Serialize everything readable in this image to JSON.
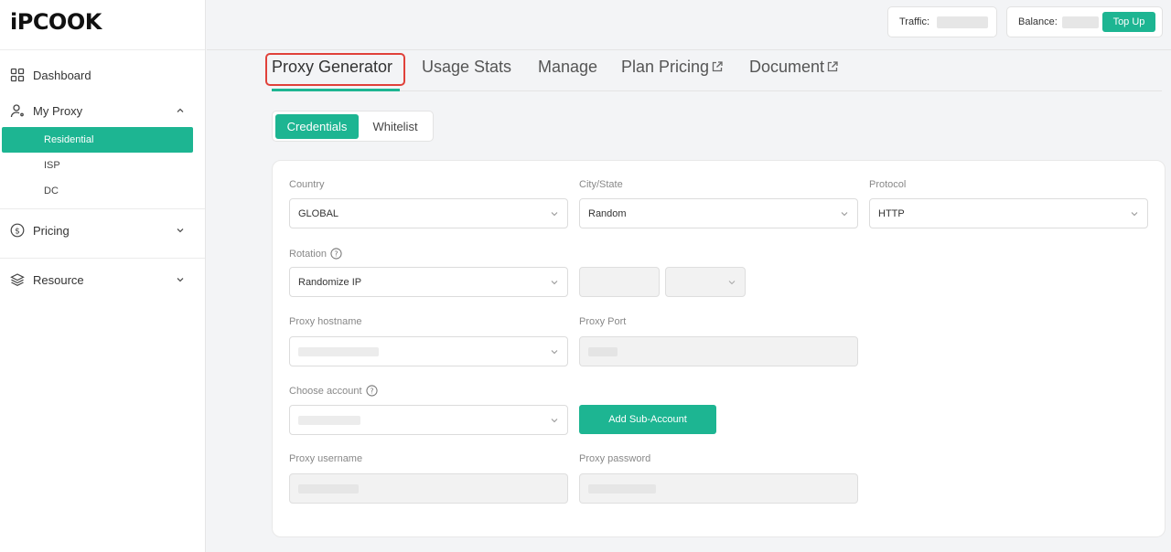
{
  "brand": {
    "logo_text": "iPCOOK",
    "accent_color": "#1db592",
    "highlight_color": "#e0413a"
  },
  "sidebar": {
    "items": [
      {
        "label": "Dashboard",
        "icon": "grid-icon"
      },
      {
        "label": "My Proxy",
        "icon": "user-icon",
        "expanded": true,
        "children": [
          {
            "label": "Residential",
            "active": true
          },
          {
            "label": "ISP"
          },
          {
            "label": "DC"
          }
        ]
      },
      {
        "label": "Pricing",
        "icon": "dollar-icon",
        "expanded": false
      },
      {
        "label": "Resource",
        "icon": "layers-icon",
        "expanded": false
      }
    ]
  },
  "topbar": {
    "traffic_label": "Traffic:",
    "balance_label": "Balance:",
    "topup_label": "Top Up"
  },
  "tabs": [
    {
      "label": "Proxy Generator",
      "active": true
    },
    {
      "label": "Usage Stats"
    },
    {
      "label": "Manage"
    },
    {
      "label": "Plan Pricing",
      "external": true
    },
    {
      "label": "Document",
      "external": true
    }
  ],
  "segments": [
    {
      "label": "Credentials",
      "active": true
    },
    {
      "label": "Whitelist"
    }
  ],
  "form": {
    "country": {
      "label": "Country",
      "value": "GLOBAL"
    },
    "city": {
      "label": "City/State",
      "value": "Random"
    },
    "protocol": {
      "label": "Protocol",
      "value": "HTTP"
    },
    "rotation": {
      "label": "Rotation",
      "value": "Randomize IP"
    },
    "hostname": {
      "label": "Proxy hostname"
    },
    "port": {
      "label": "Proxy Port"
    },
    "account": {
      "label": "Choose account"
    },
    "add_sub_account": "Add Sub-Account",
    "username": {
      "label": "Proxy username"
    },
    "password": {
      "label": "Proxy password"
    }
  }
}
